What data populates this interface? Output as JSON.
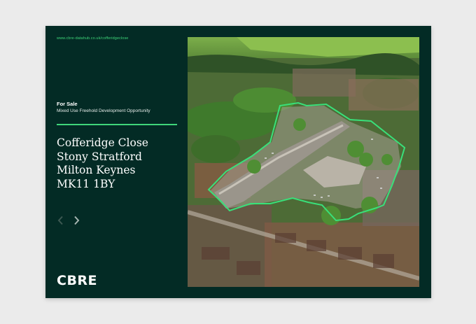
{
  "brochure": {
    "url": "www.cbre-datahub.co.uk/cofferidgeclose",
    "status": "For Sale",
    "subtitle": "Mixed Use Freehold Development Opportunity",
    "address": [
      "Cofferidge Close",
      "Stony Stratford",
      "Milton Keynes",
      "MK11 1BY"
    ],
    "logo": "CBRE"
  },
  "nav": {
    "prev_icon": "chevron-left-icon",
    "next_icon": "chevron-right-icon"
  },
  "colors": {
    "background": "#ebebeb",
    "card": "#032b25",
    "accent": "#3fd67a",
    "boundary": "#39e07a"
  }
}
